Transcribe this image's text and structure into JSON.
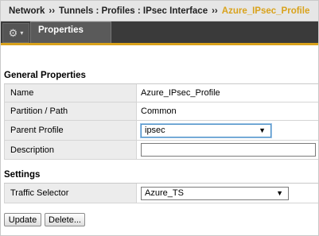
{
  "breadcrumb": {
    "items": [
      "Network",
      "Tunnels : Profiles : IPsec Interface"
    ],
    "separator": "››",
    "current": "Azure_IPsec_Profile"
  },
  "toolbar": {
    "gear_icon": "⚙",
    "chevron_icon": "▾",
    "tab_label": "Properties"
  },
  "general": {
    "title": "General Properties",
    "name_label": "Name",
    "name_value": "Azure_IPsec_Profile",
    "partition_label": "Partition / Path",
    "partition_value": "Common",
    "parent_label": "Parent Profile",
    "parent_value": "ipsec",
    "description_label": "Description",
    "description_value": ""
  },
  "settings": {
    "title": "Settings",
    "traffic_selector_label": "Traffic Selector",
    "traffic_selector_value": "Azure_TS"
  },
  "dropdown_arrow": "▼",
  "actions": {
    "update_label": "Update",
    "delete_label": "Delete..."
  },
  "colors": {
    "accent": "#d9a21b",
    "tab_bar": "#3a3a3a",
    "label_cell": "#ececec"
  }
}
